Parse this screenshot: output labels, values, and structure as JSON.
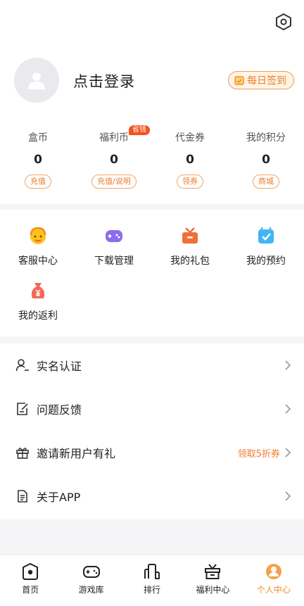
{
  "header": {
    "settings_icon": "hexagon-gear-icon",
    "login_text": "点击登录",
    "checkin_label": "每日签到"
  },
  "stats": [
    {
      "label": "盒币",
      "value": "0",
      "button": "充值"
    },
    {
      "label": "福利币",
      "value": "0",
      "button": "充值/说明",
      "badge": "省钱"
    },
    {
      "label": "代金券",
      "value": "0",
      "button": "领券"
    },
    {
      "label": "我的积分",
      "value": "0",
      "button": "商城"
    }
  ],
  "quick_links": [
    {
      "label": "客服中心",
      "icon": "customer-service-icon"
    },
    {
      "label": "下载管理",
      "icon": "gamepad-icon"
    },
    {
      "label": "我的礼包",
      "icon": "gift-icon"
    },
    {
      "label": "我的预约",
      "icon": "calendar-check-icon"
    },
    {
      "label": "我的返利",
      "icon": "money-bag-icon"
    }
  ],
  "menu": [
    {
      "label": "实名认证",
      "icon": "user-id-icon"
    },
    {
      "label": "问题反馈",
      "icon": "feedback-icon"
    },
    {
      "label": "邀请新用户有礼",
      "icon": "gift-outline-icon",
      "extra": "领取5折券"
    },
    {
      "label": "关于APP",
      "icon": "document-icon"
    }
  ],
  "tabbar": [
    {
      "label": "首页",
      "icon": "home-icon",
      "active": false
    },
    {
      "label": "游戏库",
      "icon": "controller-icon",
      "active": false
    },
    {
      "label": "排行",
      "icon": "ranking-icon",
      "active": false
    },
    {
      "label": "福利中心",
      "icon": "gift-box-icon",
      "active": false
    },
    {
      "label": "个人中心",
      "icon": "profile-icon",
      "active": true
    }
  ],
  "colors": {
    "accent": "#f08b28",
    "badge": "#f2521f"
  }
}
